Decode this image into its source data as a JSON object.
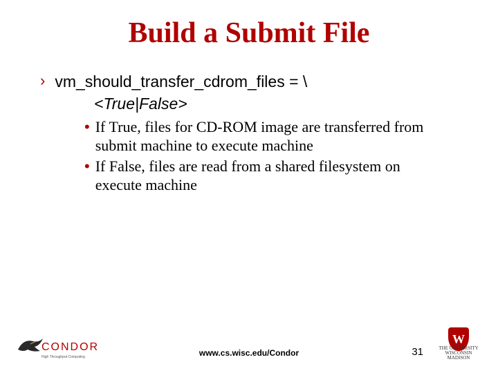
{
  "title": "Build a Submit File",
  "bullet1": {
    "mark": "›",
    "text": "vm_should_transfer_cdrom_files = \\"
  },
  "italic_line": "<True|False>",
  "sub1": {
    "mark": "•",
    "text": "If True, files for CD-ROM image are transferred from submit machine to execute machine"
  },
  "sub2": {
    "mark": "•",
    "text": "If False, files are read from a shared filesystem on execute machine"
  },
  "footer": {
    "url": "www.cs.wisc.edu/Condor",
    "page": "31"
  },
  "logos": {
    "condor_word": "CONDOR",
    "condor_tag": "High Throughput Computing",
    "crest_w": "W",
    "crest_line1": "THE UNIVERSITY",
    "crest_line2": "WISCONSIN",
    "crest_line3": "MADISON"
  }
}
